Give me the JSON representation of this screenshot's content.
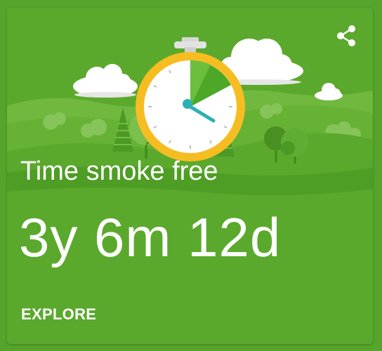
{
  "card": {
    "title": "Time smoke free",
    "value": "3y 6m 12d",
    "action_label": "EXPLORE"
  },
  "icons": {
    "share": "share-icon",
    "stopwatch": "stopwatch-icon"
  },
  "colors": {
    "background": "#5aa92c",
    "text": "#ffffff",
    "clock_ring": "#f6bd22",
    "clock_hand": "#2bb1b5",
    "clock_fill": "#4ca826"
  }
}
